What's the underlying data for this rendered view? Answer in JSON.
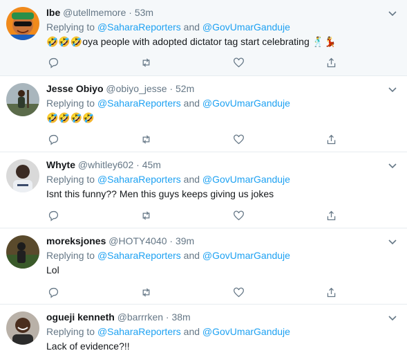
{
  "tweets": [
    {
      "name": "Ibe",
      "handle": "@utellmemore",
      "separator": "·",
      "time": "53m",
      "replying_prefix": "Replying to",
      "mention1": "@SaharaReporters",
      "conj": "and",
      "mention2": "@GovUmarGanduje",
      "body": "🤣🤣🤣oya people with adopted dictator tag start celebrating 🕺💃",
      "highlighted": true,
      "avatar": "face-with-sunglasses-avatar"
    },
    {
      "name": "Jesse Obiyo",
      "handle": "@obiyo_jesse",
      "separator": "·",
      "time": "52m",
      "replying_prefix": "Replying to",
      "mention1": "@SaharaReporters",
      "conj": "and",
      "mention2": "@GovUmarGanduje",
      "body": "🤣🤣🤣🤣",
      "highlighted": false,
      "avatar": "outdoor-person-avatar"
    },
    {
      "name": "Whyte",
      "handle": "@whitley602",
      "separator": "·",
      "time": "45m",
      "replying_prefix": "Replying to",
      "mention1": "@SaharaReporters",
      "conj": "and",
      "mention2": "@GovUmarGanduje",
      "body": "Isnt this funny?? Men this guys keeps giving us jokes",
      "highlighted": false,
      "avatar": "person-portrait-avatar"
    },
    {
      "name": "moreksjones",
      "handle": "@HOTY4040",
      "separator": "·",
      "time": "39m",
      "replying_prefix": "Replying to",
      "mention1": "@SaharaReporters",
      "conj": "and",
      "mention2": "@GovUmarGanduje",
      "body": "Lol",
      "highlighted": false,
      "avatar": "dark-figure-avatar"
    },
    {
      "name": "ogueji kenneth",
      "handle": "@barrrken",
      "separator": "·",
      "time": "38m",
      "replying_prefix": "Replying to",
      "mention1": "@SaharaReporters",
      "conj": "and",
      "mention2": "@GovUmarGanduje",
      "body": "Lack of evidence?!!",
      "highlighted": false,
      "avatar": "smiling-person-avatar"
    }
  ],
  "colors": {
    "accent": "#1da1f2",
    "secondary_text": "#657786",
    "primary_text": "#14171a",
    "divider": "#e6ecf0",
    "highlight_bg": "#f5f8fa"
  },
  "icons": [
    "chevron-down-icon",
    "reply-icon",
    "retweet-icon",
    "like-icon",
    "share-icon"
  ]
}
